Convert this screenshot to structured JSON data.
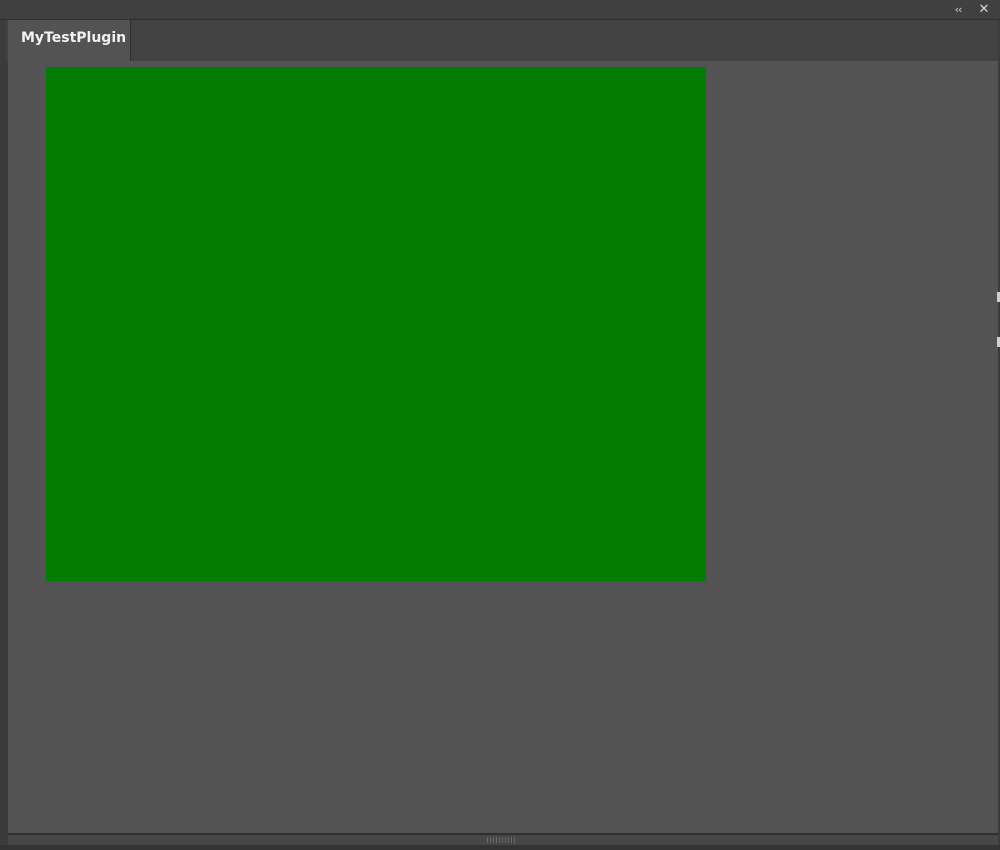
{
  "titlebar": {
    "collapse_glyph": "‹‹",
    "close_glyph": "✕"
  },
  "tabs": [
    {
      "label": "MyTestPlugin",
      "active": true
    }
  ],
  "content": {
    "canvas_color": "#027c02",
    "background_color": "#535353"
  },
  "icons": {
    "collapse": "double-chevron-left-icon",
    "close": "close-icon",
    "grip": "resize-grip-icon"
  }
}
